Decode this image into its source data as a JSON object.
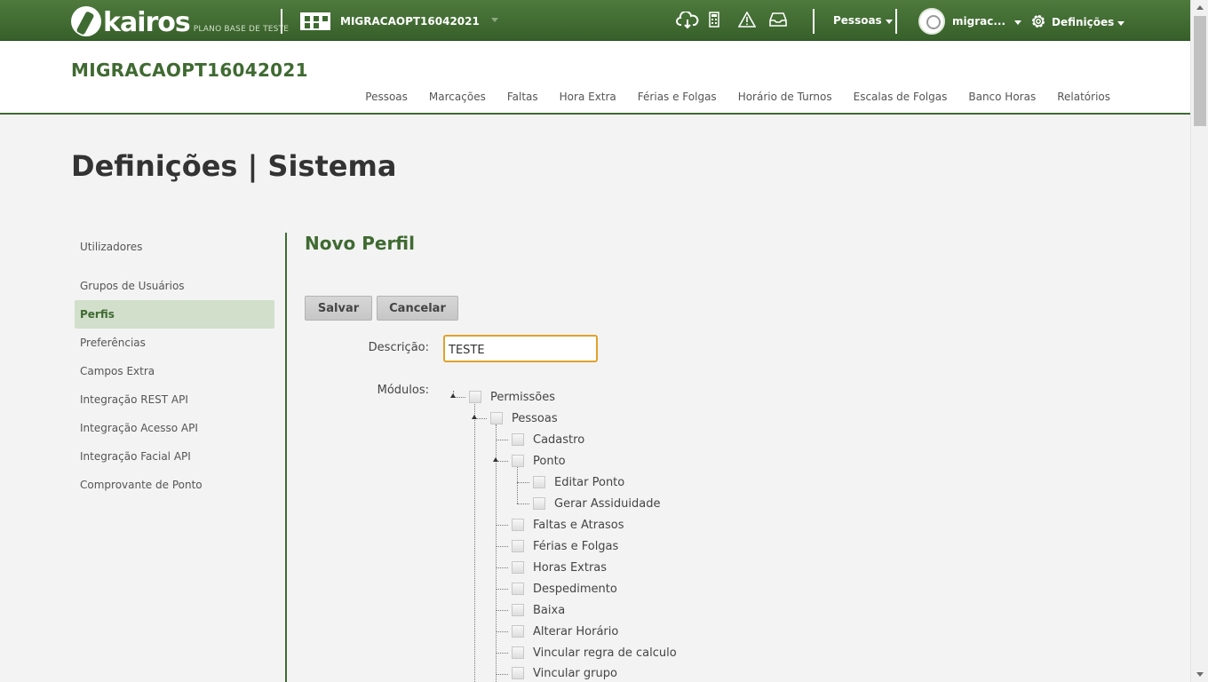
{
  "topbar": {
    "logo_text": "kairos",
    "plan_text": "PLANO BASE DE TESTE",
    "company": "MIGRACAOPT16042021",
    "icons": [
      "cloud-download-icon",
      "calculator-icon",
      "warning-icon",
      "inbox-icon"
    ],
    "people_menu": "Pessoas",
    "user_menu": "migrac...",
    "settings_menu": "Definições"
  },
  "header": {
    "company_title": "MIGRACAOPT16042021",
    "nav": [
      "Pessoas",
      "Marcações",
      "Faltas",
      "Hora Extra",
      "Férias e Folgas",
      "Horário de Turnos",
      "Escalas de Folgas",
      "Banco Horas",
      "Relatórios"
    ]
  },
  "page": {
    "title": "Definições | Sistema"
  },
  "sidebar": {
    "items": [
      {
        "label": "Utilizadores"
      },
      {
        "label": "Grupos de Usuários"
      },
      {
        "label": "Perfis",
        "active": true
      },
      {
        "label": "Preferências"
      },
      {
        "label": "Campos Extra"
      },
      {
        "label": "Integração REST API"
      },
      {
        "label": "Integração Acesso API"
      },
      {
        "label": "Integração Facial API"
      },
      {
        "label": "Comprovante de Ponto"
      }
    ]
  },
  "form": {
    "section_title": "Novo Perfil",
    "save_label": "Salvar",
    "cancel_label": "Cancelar",
    "description_label": "Descrição:",
    "description_value": "TESTE",
    "modules_label": "Módulos:"
  },
  "tree": {
    "root": "Permissões",
    "pessoas": "Pessoas",
    "cadastro": "Cadastro",
    "ponto": "Ponto",
    "editar_ponto": "Editar Ponto",
    "gerar_assiduidade": "Gerar Assiduidade",
    "faltas_atrasos": "Faltas e Atrasos",
    "ferias_folgas": "Férias e Folgas",
    "horas_extras": "Horas Extras",
    "despedimento": "Despedimento",
    "baixa": "Baixa",
    "alterar_horario": "Alterar Horário",
    "vincular_regra": "Vincular regra de calculo",
    "vincular_grupo": "Vincular grupo"
  },
  "colors": {
    "brand_green": "#3f6a31",
    "active_bg": "#d1dfcb",
    "focus_border": "#e0a22a"
  }
}
